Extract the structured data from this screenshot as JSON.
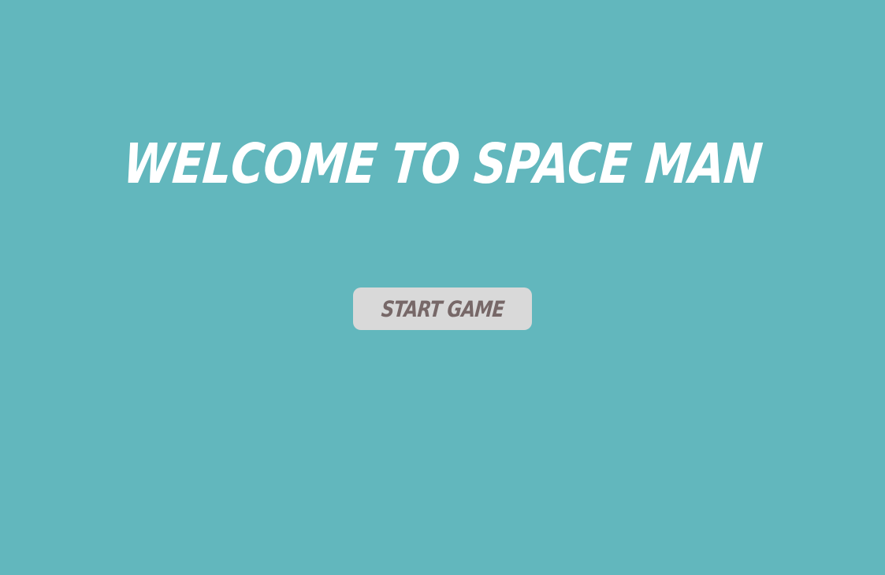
{
  "screen": {
    "title": "WELCOME TO SPACE MAN",
    "start_button_label": "START GAME"
  },
  "colors": {
    "background": "#62b7bd",
    "title_text": "#ffffff",
    "button_background": "#d9d9d9",
    "button_text": "#776868"
  }
}
